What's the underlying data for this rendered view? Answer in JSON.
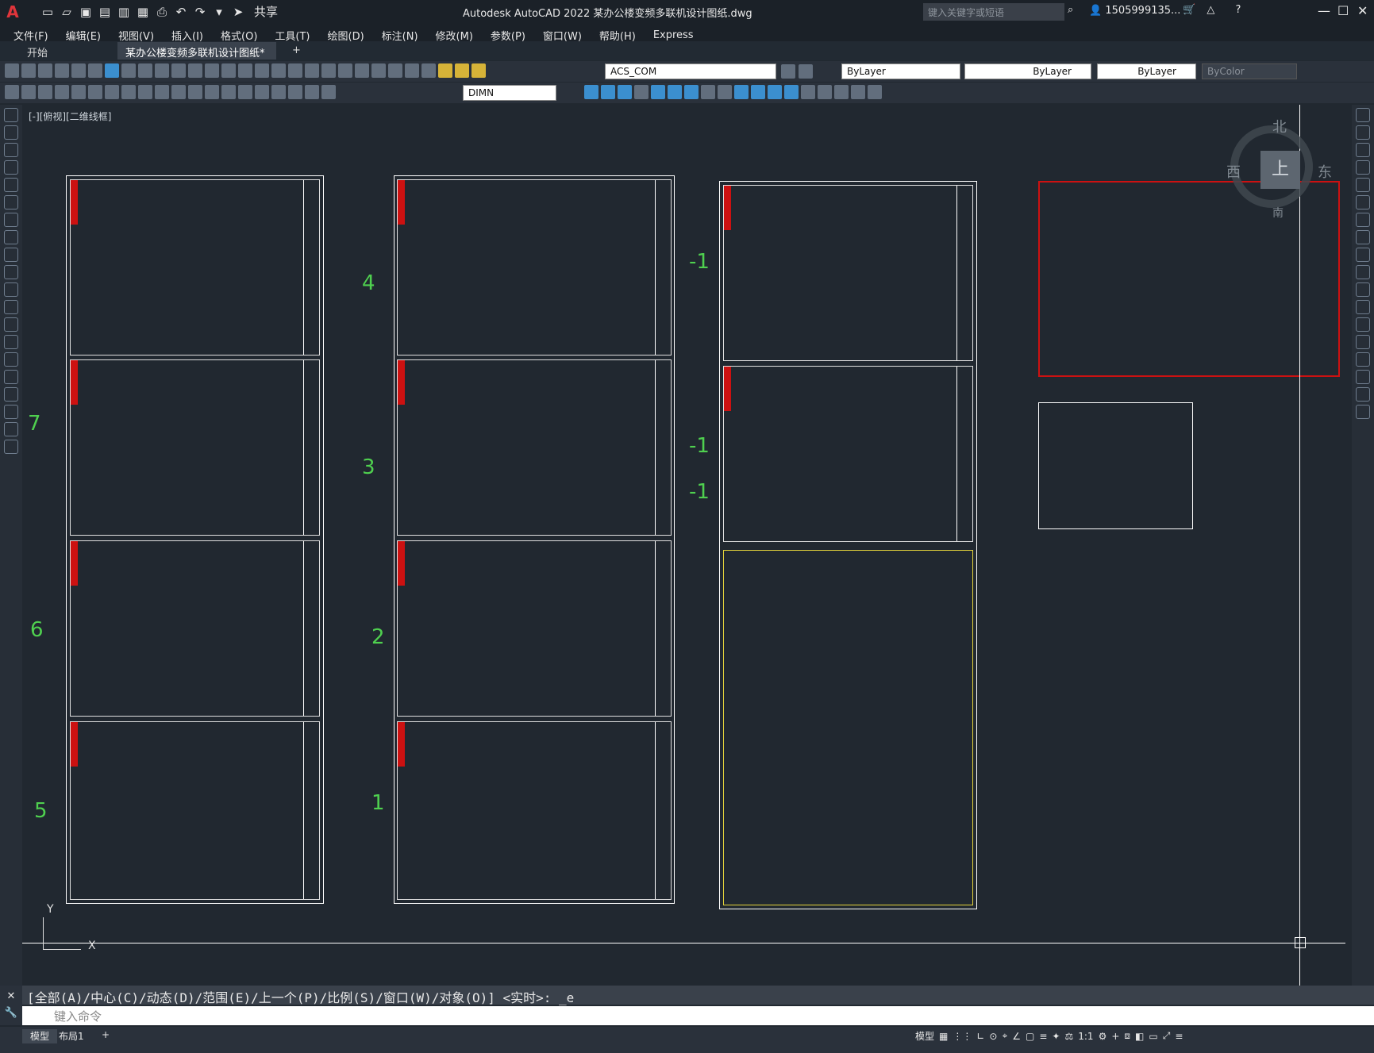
{
  "app": {
    "logo": "A",
    "share_label": "共享",
    "title": "Autodesk AutoCAD 2022    某办公楼变频多联机设计图纸.dwg",
    "search_placeholder": "键入关键字或短语",
    "user": "1505999135..."
  },
  "menu": [
    "文件(F)",
    "编辑(E)",
    "视图(V)",
    "插入(I)",
    "格式(O)",
    "工具(T)",
    "绘图(D)",
    "标注(N)",
    "修改(M)",
    "参数(P)",
    "窗口(W)",
    "帮助(H)",
    "Express"
  ],
  "tabs": {
    "start": "开始",
    "drawing": "某办公楼变频多联机设计图纸*",
    "close": "✕",
    "add": "+"
  },
  "toolbar": {
    "layer": "ACS_COM",
    "color": "ByLayer",
    "linetype": "ByLayer",
    "lineweight": "ByLayer",
    "plotstyle": "ByColor",
    "dimstyle": "DIMN"
  },
  "canvas": {
    "view_label": "[-][俯视][二维线框]",
    "compass": {
      "n": "北",
      "w": "西",
      "e": "东",
      "top": "上",
      "s": "南"
    },
    "axis_y": "Y",
    "axis_x": "X",
    "floor_labels_col1": [
      "7",
      "6",
      "5"
    ],
    "floor_labels_col2": [
      "4",
      "3",
      "2",
      "1"
    ],
    "floor_labels_col3": [
      "-1",
      "-1",
      "-1"
    ]
  },
  "command": {
    "history": "[全部(A)/中心(C)/动态(D)/范围(E)/上一个(P)/比例(S)/窗口(W)/对象(O)] <实时>: _e",
    "placeholder": "键入命令"
  },
  "status": {
    "model": "模型",
    "layout1": "布局1",
    "add": "+",
    "model_btn": "模型",
    "scale": "1:1"
  }
}
